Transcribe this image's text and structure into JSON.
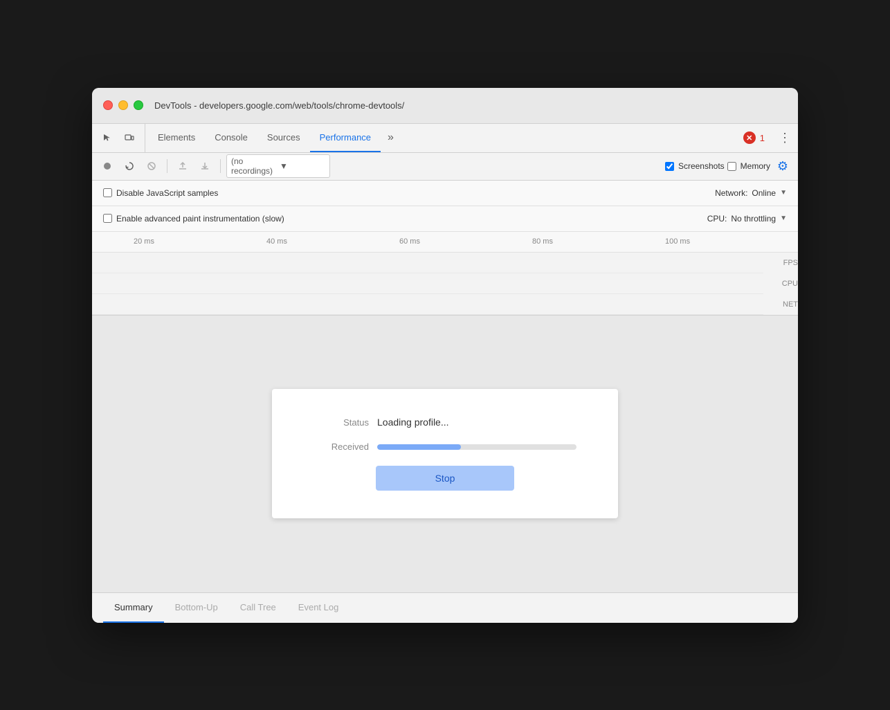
{
  "window": {
    "title": "DevTools - developers.google.com/web/tools/chrome-devtools/"
  },
  "tabs": {
    "items": [
      {
        "id": "elements",
        "label": "Elements"
      },
      {
        "id": "console",
        "label": "Console"
      },
      {
        "id": "sources",
        "label": "Sources"
      },
      {
        "id": "performance",
        "label": "Performance"
      }
    ],
    "more_label": "»",
    "error_count": "1",
    "menu_icon": "⋮"
  },
  "toolbar": {
    "record_title": "(no recordings)",
    "screenshots_label": "Screenshots",
    "memory_label": "Memory"
  },
  "settings": {
    "disable_js_label": "Disable JavaScript samples",
    "enable_paint_label": "Enable advanced paint instrumentation (slow)",
    "network_label": "Network:",
    "network_value": "Online",
    "cpu_label": "CPU:",
    "cpu_value": "No throttling"
  },
  "timeline": {
    "ticks": [
      "20 ms",
      "40 ms",
      "60 ms",
      "80 ms",
      "100 ms"
    ],
    "labels": [
      "FPS",
      "CPU",
      "NET"
    ]
  },
  "loading_dialog": {
    "status_key": "Status",
    "status_value": "Loading profile...",
    "received_key": "Received",
    "progress_percent": 42,
    "stop_label": "Stop"
  },
  "bottom_tabs": {
    "items": [
      {
        "id": "summary",
        "label": "Summary",
        "active": true
      },
      {
        "id": "bottom-up",
        "label": "Bottom-Up"
      },
      {
        "id": "call-tree",
        "label": "Call Tree"
      },
      {
        "id": "event-log",
        "label": "Event Log"
      }
    ]
  },
  "colors": {
    "active_tab": "#1a73e8",
    "progress_fill": "#7baaf7",
    "stop_bg": "#a8c7fa",
    "stop_text": "#1a56c4"
  }
}
